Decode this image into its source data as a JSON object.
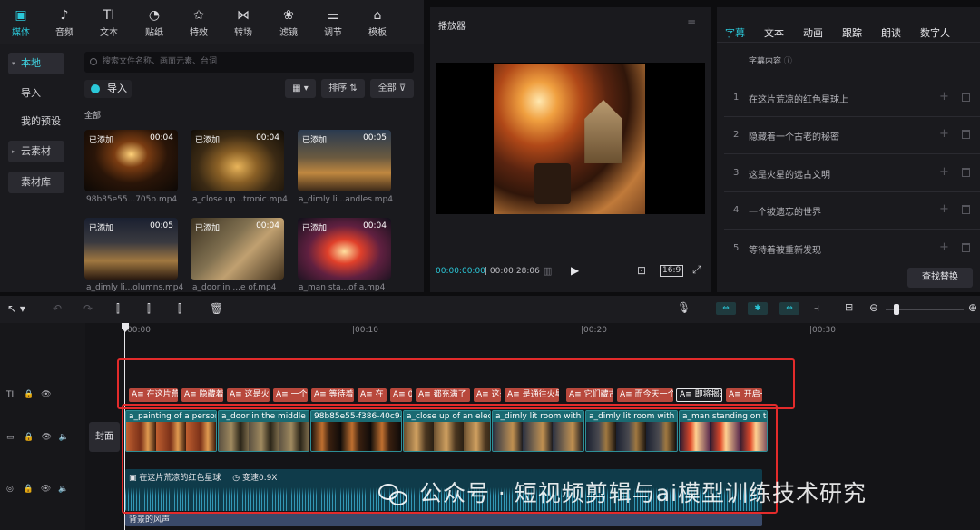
{
  "toolbar": {
    "items": [
      {
        "label": "媒体",
        "icon": "media-icon"
      },
      {
        "label": "音频",
        "icon": "audio-icon"
      },
      {
        "label": "文本",
        "icon": "text-icon"
      },
      {
        "label": "贴纸",
        "icon": "sticker-icon"
      },
      {
        "label": "特效",
        "icon": "effects-icon"
      },
      {
        "label": "转场",
        "icon": "transition-icon"
      },
      {
        "label": "滤镜",
        "icon": "filter-icon"
      },
      {
        "label": "调节",
        "icon": "adjust-icon"
      },
      {
        "label": "模板",
        "icon": "template-icon"
      }
    ]
  },
  "sidebar": {
    "items": [
      {
        "label": "本地"
      },
      {
        "label": "导入"
      },
      {
        "label": "我的预设"
      },
      {
        "label": "云素材"
      },
      {
        "label": "素材库"
      }
    ]
  },
  "media": {
    "search_placeholder": "搜索文件名称、画面元素、台词",
    "import_label": "导入",
    "sort_label": "排序",
    "all_filter_label": "全部",
    "section_label": "全部",
    "items": [
      {
        "tag": "已添加",
        "duration": "00:04",
        "name": "98b85e55...705b.mp4"
      },
      {
        "tag": "已添加",
        "duration": "00:04",
        "name": "a_close up...tronic.mp4"
      },
      {
        "tag": "已添加",
        "duration": "00:05",
        "name": "a_dimly li...andles.mp4"
      },
      {
        "tag": "已添加",
        "duration": "00:05",
        "name": "a_dimly li...olumns.mp4"
      },
      {
        "tag": "已添加",
        "duration": "00:04",
        "name": "a_door in ...e of.mp4"
      },
      {
        "tag": "已添加",
        "duration": "00:04",
        "name": "a_man sta...of a.mp4"
      }
    ]
  },
  "player": {
    "title": "播放器",
    "current_time": "00:00:00:00",
    "total_time": "00:00:28:06",
    "ratio": "16:9"
  },
  "right_panel": {
    "tabs": [
      "字幕",
      "文本",
      "动画",
      "跟踪",
      "朗读",
      "数字人"
    ],
    "header": "字幕内容",
    "subtitles": [
      {
        "num": "1",
        "text": "在这片荒凉的红色星球上"
      },
      {
        "num": "2",
        "text": "隐藏着一个古老的秘密"
      },
      {
        "num": "3",
        "text": "这是火星的远古文明"
      },
      {
        "num": "4",
        "text": "一个被遗忘的世界"
      },
      {
        "num": "5",
        "text": "等待着被重新发现"
      }
    ],
    "find_replace_label": "查找替换"
  },
  "timeline": {
    "ruler": [
      "00:00",
      "|00:10",
      "|00:20",
      "|00:30"
    ],
    "cover_label": "封面",
    "subtitle_clips": [
      "在这片荒",
      "隐藏着",
      "这是火",
      "一个",
      "等待着",
      "在",
      "0",
      "都充满了",
      "这是",
      "是通往火星",
      "它们藏古",
      "而今天一个",
      "即将揭开",
      "开启一"
    ],
    "video_clips": [
      "a_painting of a person",
      "a_door in the middle of",
      "98b85e55-f386-40c9-b",
      "a_close up of an electr",
      "a_dimly lit room with ca",
      "a_dimly lit room with co",
      "a_man standing on top"
    ],
    "audio_clip": {
      "title": "在这片荒凉的红色星球",
      "speed": "变速0.9X"
    },
    "bgm_label": "背景的风声"
  },
  "watermark": "公众号 · 短视频剪辑与ai模型训练技术研究",
  "colors": {
    "accent": "#2bc8d9",
    "subtitle_clip": "#b8483c",
    "video_clip": "#1f5c62",
    "highlight": "#e32b2b"
  }
}
